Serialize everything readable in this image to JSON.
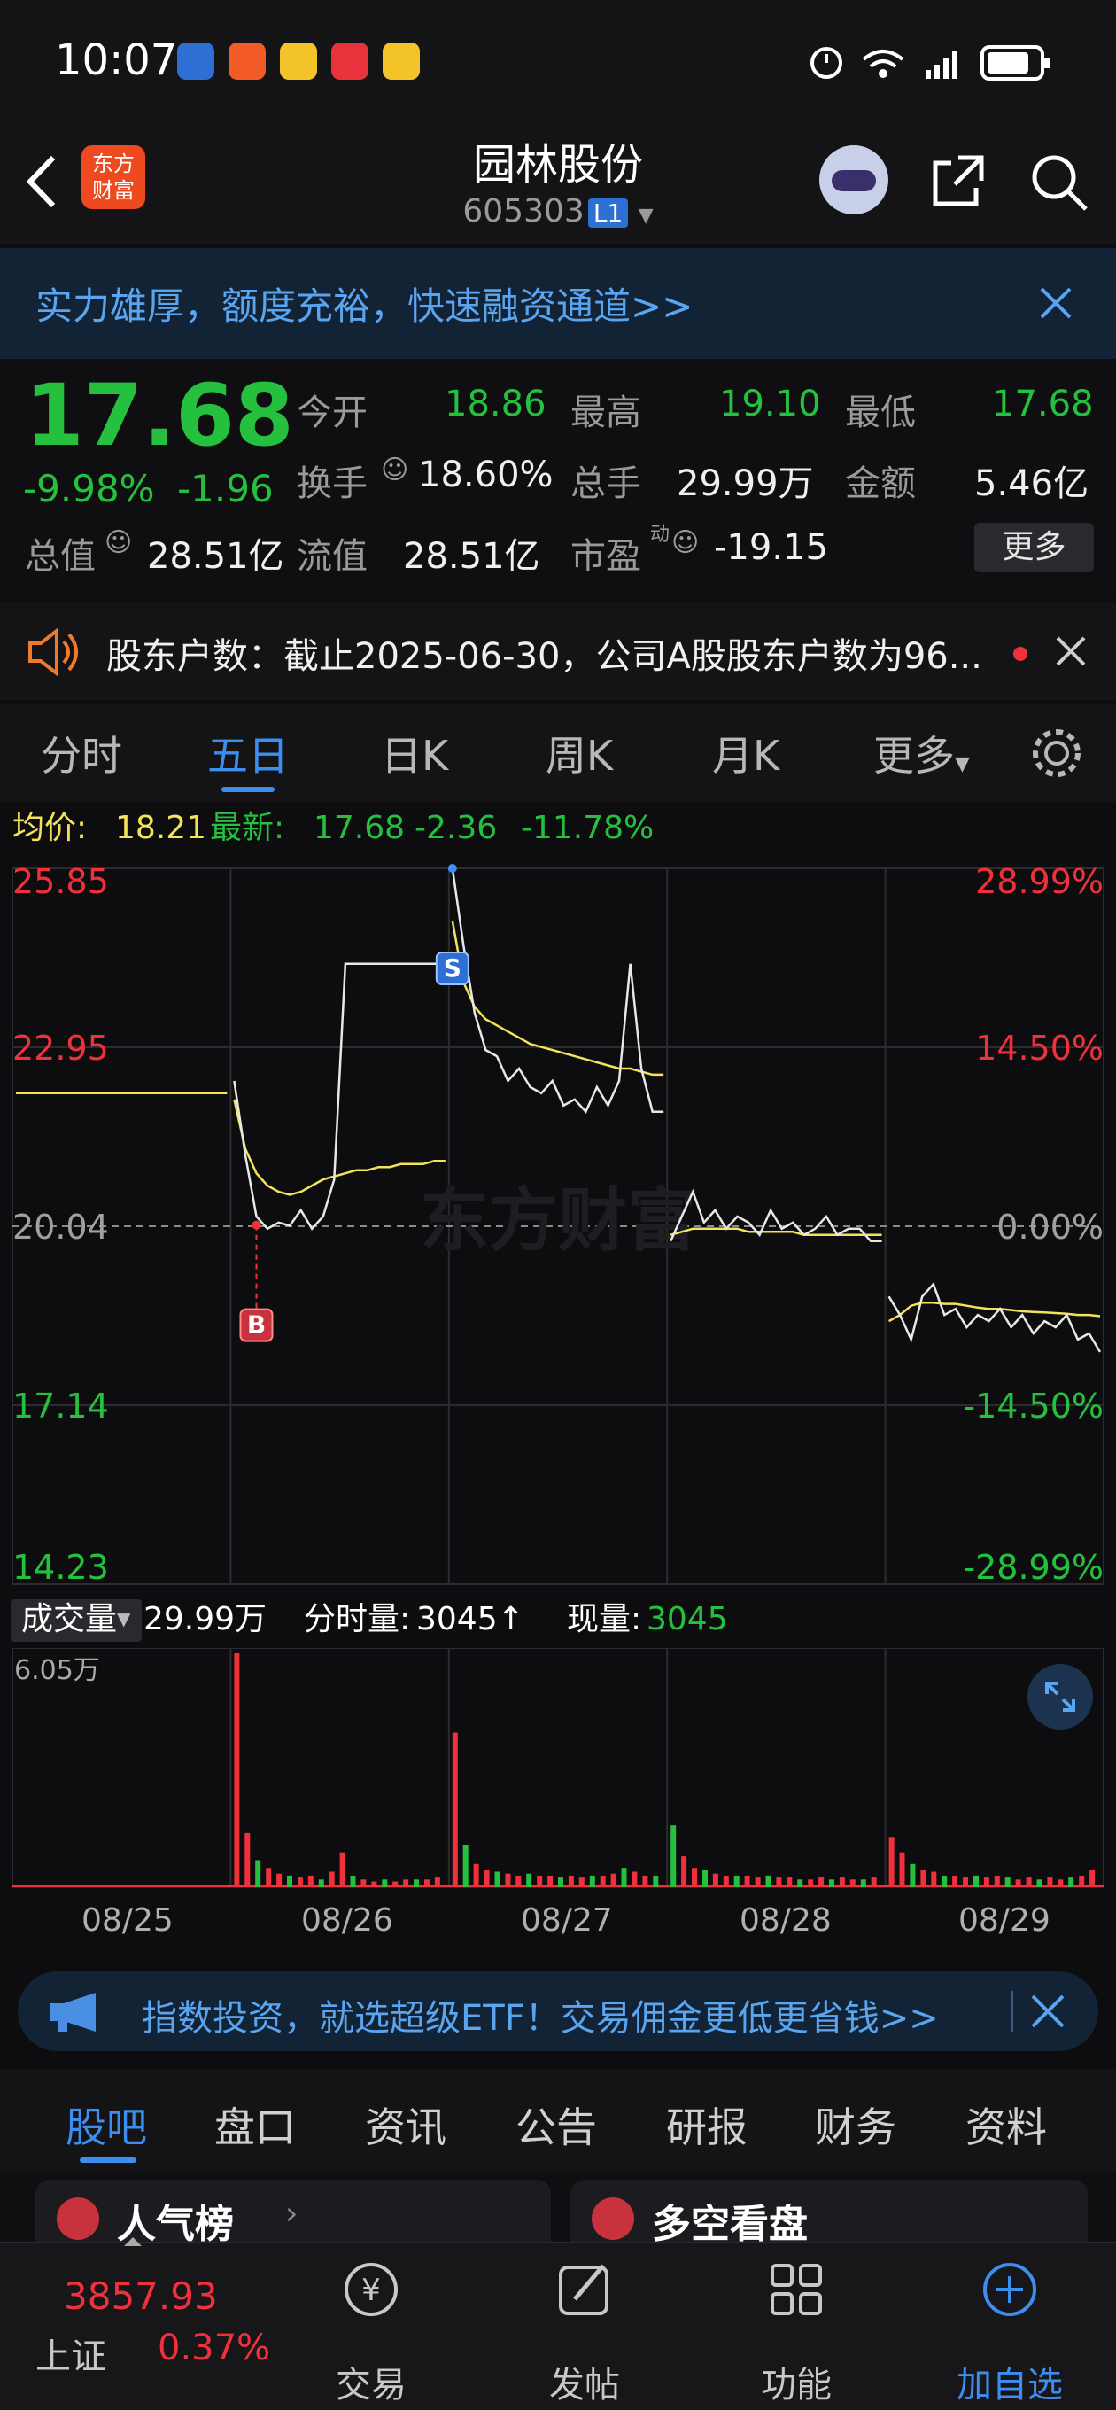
{
  "status_bar": {
    "time": "10:07"
  },
  "header": {
    "title": "园林股份",
    "code": "605303",
    "level": "L1",
    "logo_line1": "东方",
    "logo_line2": "财富"
  },
  "promo_banner": {
    "text": "实力雄厚，额度充裕，快速融资通道>>"
  },
  "quote": {
    "price": "17.68",
    "change_pct": "-9.98%",
    "change": "-1.96",
    "open_label": "今开",
    "open": "18.86",
    "high_label": "最高",
    "high": "19.10",
    "low_label": "最低",
    "low": "17.68",
    "turnover_label": "换手",
    "turnover": "18.60%",
    "volume_label": "总手",
    "volume": "29.99万",
    "amount_label": "金额",
    "amount": "5.46亿",
    "mktcap_label": "总值",
    "mktcap": "28.51亿",
    "float_label": "流值",
    "float": "28.51亿",
    "pe_label": "市盈",
    "pe_sup": "动",
    "pe": "-19.15",
    "more": "更多"
  },
  "notice": {
    "text": "股东户数：截止2025-06-30，公司A股股东户数为96..."
  },
  "chart_tabs": [
    "分时",
    "五日",
    "日K",
    "周K",
    "月K",
    "更多"
  ],
  "info_line": {
    "avg_label": "均价:",
    "avg": "18.21",
    "latest_label": "最新:",
    "latest": "17.68",
    "chg": "-2.36",
    "chg_pct": "-11.78%"
  },
  "chart_data": {
    "type": "line",
    "x_labels": [
      "08/25",
      "08/26",
      "08/27",
      "08/28",
      "08/29"
    ],
    "y_ticks_left": [
      "25.85",
      "22.95",
      "20.04",
      "17.14",
      "14.23"
    ],
    "y_ticks_right": [
      "28.99%",
      "14.50%",
      "0.00%",
      "-14.50%",
      "-28.99%"
    ],
    "ylim": [
      14.23,
      25.85
    ],
    "base": 20.04,
    "watermark": "东方财富",
    "markers": {
      "buy": "B",
      "sell": "S"
    },
    "series": [
      {
        "name": "最新",
        "color": "#e8e8e8",
        "days": [
          [],
          [
            22.4,
            21.2,
            20.2,
            20.0,
            20.1,
            20.05,
            20.3,
            20.0,
            20.2,
            20.8,
            24.3,
            24.3,
            24.3,
            24.3,
            24.3,
            24.3,
            24.3,
            24.3,
            24.3,
            24.3
          ],
          [
            25.85,
            24.6,
            23.5,
            22.9,
            22.8,
            22.4,
            22.6,
            22.3,
            22.2,
            22.4,
            22.0,
            22.1,
            21.9,
            22.3,
            22.0,
            22.4,
            24.3,
            22.6,
            21.9,
            21.9
          ],
          [
            19.8,
            20.2,
            20.6,
            20.1,
            20.3,
            20.0,
            20.2,
            20.1,
            19.9,
            20.3,
            20.0,
            20.1,
            19.9,
            20.0,
            20.2,
            19.9,
            20.0,
            20.0,
            19.8,
            19.8
          ],
          [
            18.9,
            18.6,
            18.2,
            18.9,
            19.1,
            18.6,
            18.7,
            18.4,
            18.6,
            18.5,
            18.7,
            18.4,
            18.6,
            18.3,
            18.5,
            18.4,
            18.6,
            18.2,
            18.3,
            18.0
          ]
        ]
      },
      {
        "name": "均价",
        "color": "#f4e25a",
        "days": [
          [
            22.2,
            22.2,
            22.2,
            22.2,
            22.2,
            22.2,
            22.2,
            22.2,
            22.2,
            22.2,
            22.2,
            22.2,
            22.2,
            22.2,
            22.2,
            22.2,
            22.2,
            22.2,
            22.2,
            22.2
          ],
          [
            22.1,
            21.3,
            20.9,
            20.7,
            20.6,
            20.55,
            20.6,
            20.7,
            20.8,
            20.85,
            20.9,
            20.95,
            20.95,
            21.0,
            21.0,
            21.05,
            21.05,
            21.05,
            21.1,
            21.1
          ],
          [
            25.0,
            24.0,
            23.6,
            23.4,
            23.3,
            23.2,
            23.1,
            23.0,
            22.95,
            22.9,
            22.85,
            22.8,
            22.75,
            22.7,
            22.65,
            22.6,
            22.6,
            22.55,
            22.5,
            22.5
          ],
          [
            19.9,
            19.95,
            20.0,
            20.0,
            20.0,
            20.0,
            20.0,
            19.95,
            19.95,
            19.95,
            19.95,
            19.95,
            19.9,
            19.9,
            19.9,
            19.9,
            19.9,
            19.9,
            19.9,
            19.9
          ],
          [
            18.5,
            18.6,
            18.75,
            18.8,
            18.8,
            18.78,
            18.78,
            18.75,
            18.72,
            18.7,
            18.7,
            18.68,
            18.66,
            18.65,
            18.64,
            18.63,
            18.62,
            18.6,
            18.6,
            18.58
          ]
        ]
      }
    ]
  },
  "volume": {
    "label": "成交量",
    "total": "29.99万",
    "tick_label": "分时量:",
    "tick": "3045↑",
    "now_label": "现量:",
    "now": "3045",
    "max_label": "6.05万",
    "days": [
      [
        0,
        0,
        0,
        0,
        0,
        0,
        0,
        0,
        0,
        0,
        0,
        0,
        0,
        0,
        0,
        0,
        0,
        0,
        0,
        0
      ],
      [
        6.05,
        1.4,
        0.7,
        0.5,
        0.35,
        0.3,
        0.25,
        0.3,
        0.2,
        0.4,
        0.9,
        0.3,
        0.2,
        0.15,
        0.2,
        0.15,
        0.2,
        0.2,
        0.2,
        0.25
      ],
      [
        4.0,
        1.1,
        0.6,
        0.45,
        0.4,
        0.35,
        0.3,
        0.35,
        0.3,
        0.3,
        0.25,
        0.3,
        0.25,
        0.3,
        0.3,
        0.35,
        0.5,
        0.4,
        0.3,
        0.3
      ],
      [
        1.6,
        0.8,
        0.5,
        0.45,
        0.35,
        0.3,
        0.3,
        0.3,
        0.25,
        0.3,
        0.25,
        0.25,
        0.2,
        0.2,
        0.25,
        0.2,
        0.25,
        0.2,
        0.2,
        0.25
      ],
      [
        1.3,
        0.9,
        0.6,
        0.45,
        0.4,
        0.3,
        0.3,
        0.25,
        0.3,
        0.25,
        0.3,
        0.25,
        0.2,
        0.25,
        0.2,
        0.25,
        0.2,
        0.25,
        0.3,
        0.45
      ]
    ]
  },
  "etf_banner": {
    "text": "指数投资，就选超级ETF！交易佣金更低更省钱>>"
  },
  "sub_tabs": [
    "股吧",
    "盘口",
    "资讯",
    "公告",
    "研报",
    "财务",
    "资料"
  ],
  "cards": {
    "left": "人气榜",
    "right": "多空看盘"
  },
  "bottom_nav": {
    "index_value": "3857.93",
    "index_name": "上证",
    "index_pct": "0.37%",
    "trade": "交易",
    "post": "发帖",
    "func": "功能",
    "add": "加自选"
  },
  "colors": {
    "up": "#f0303a",
    "down": "#25c13e",
    "accent": "#3c8ef0",
    "avg": "#f4e25a"
  }
}
